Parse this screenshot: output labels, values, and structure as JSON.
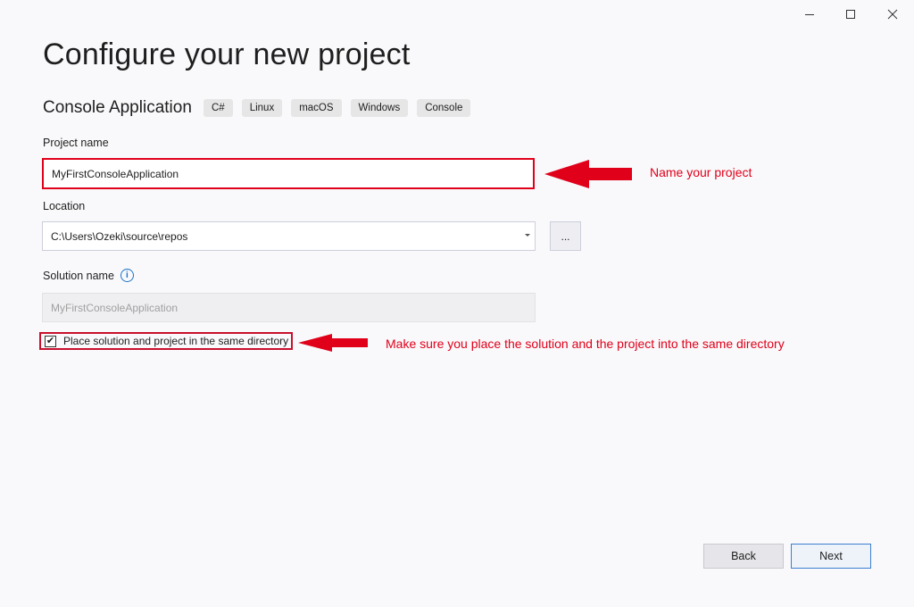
{
  "window": {
    "minimize": "minimize",
    "maximize": "maximize",
    "close": "close"
  },
  "title": "Configure your new project",
  "template": {
    "name": "Console Application",
    "tags": [
      "C#",
      "Linux",
      "macOS",
      "Windows",
      "Console"
    ]
  },
  "project_name": {
    "label": "Project name",
    "value": "MyFirstConsoleApplication"
  },
  "location": {
    "label": "Location",
    "value": "C:\\Users\\Ozeki\\source\\repos",
    "browse_label": "..."
  },
  "solution_name": {
    "label": "Solution name",
    "value": "MyFirstConsoleApplication"
  },
  "same_directory": {
    "label": "Place solution and project in the same directory",
    "checked": true,
    "check_glyph": "✔"
  },
  "annotations": {
    "name_project": "Name your project",
    "same_directory": "Make sure you place the solution and the project into the same directory",
    "color": "#e0001a"
  },
  "buttons": {
    "back": "Back",
    "next": "Next"
  },
  "icons": {
    "info": "info-icon",
    "dropdown": "chevron-down-icon",
    "annotation_arrow": "arrow-left-icon"
  }
}
